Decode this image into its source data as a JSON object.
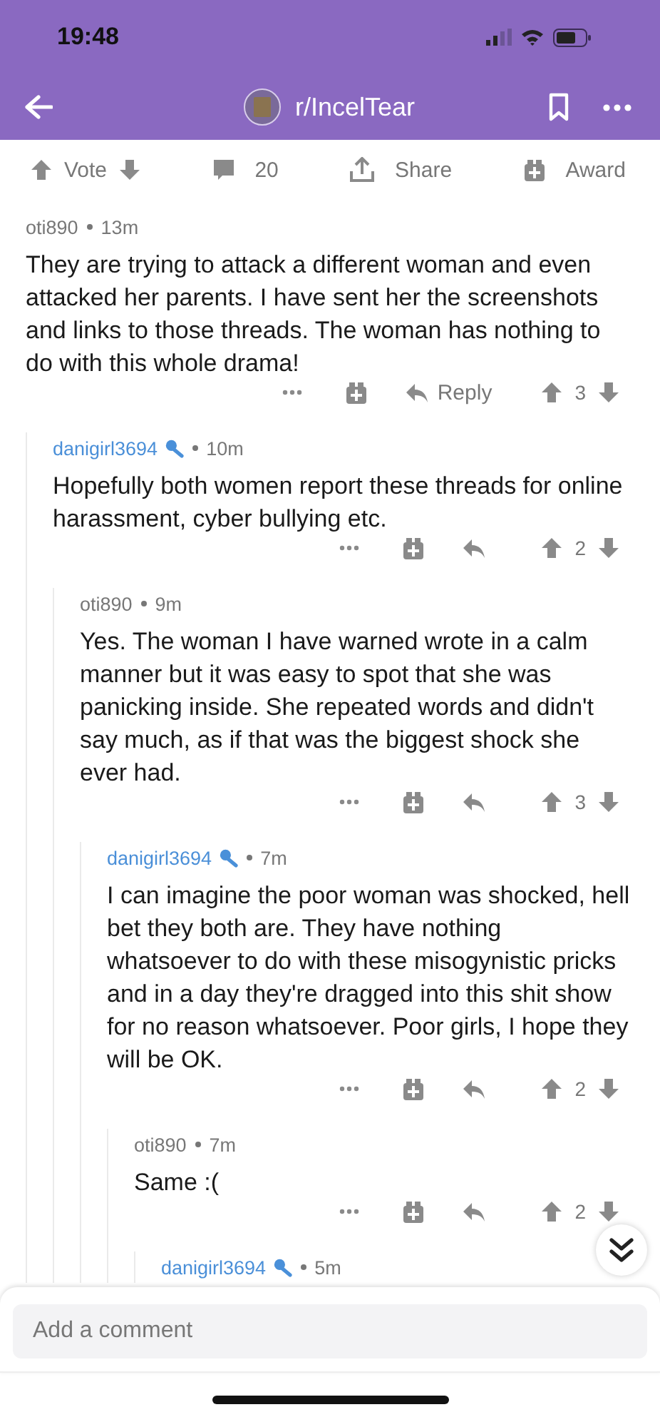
{
  "status_bar": {
    "time": "19:48"
  },
  "header": {
    "subreddit": "r/IncelTear"
  },
  "post_actions": {
    "vote_label": "Vote",
    "comment_count": "20",
    "share_label": "Share",
    "award_label": "Award"
  },
  "comments": [
    {
      "author": "oti890",
      "op": false,
      "age": "13m",
      "body": "They are trying to attack a different woman and even attacked her parents. I have sent her the screenshots and links to those threads. The woman has nothing to do with this whole drama!",
      "score": "3",
      "reply_label": "Reply",
      "children": [
        {
          "author": "danigirl3694",
          "op": true,
          "age": "10m",
          "body": "Hopefully both women report these threads for online harassment, cyber bullying etc.",
          "score": "2",
          "children": [
            {
              "author": "oti890",
              "op": false,
              "age": "9m",
              "body": "Yes. The woman I have warned wrote in a calm manner but it was easy to spot that she was panicking inside. She repeated words and didn't say much, as if that was the biggest shock she ever had.",
              "score": "3",
              "children": [
                {
                  "author": "danigirl3694",
                  "op": true,
                  "age": "7m",
                  "body": "I can imagine the poor woman was shocked, hell bet they both are. They have nothing whatsoever to do with these misogynistic pricks and in a day they're dragged into this shit show for no reason whatsoever. Poor girls, I hope they will be OK.",
                  "score": "2",
                  "children": [
                    {
                      "author": "oti890",
                      "op": false,
                      "age": "7m",
                      "body": "Same :(",
                      "score": "2",
                      "children": [
                        {
                          "author": "danigirl3694",
                          "op": true,
                          "age": "5m"
                        }
                      ]
                    }
                  ]
                }
              ]
            }
          ]
        }
      ]
    }
  ],
  "comment_box": {
    "placeholder": "Add a comment"
  }
}
